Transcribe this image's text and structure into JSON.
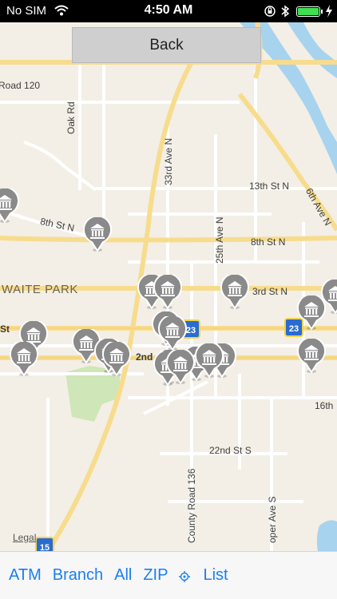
{
  "status": {
    "carrier": "No SIM",
    "time": "4:50 AM",
    "battery_level": 1.0,
    "icons": [
      "wifi-icon",
      "orientation-lock-icon",
      "bluetooth-icon",
      "battery-icon",
      "charging-bolt-icon"
    ]
  },
  "back_button": {
    "label": "Back"
  },
  "map": {
    "streets": {
      "road120": "Road 120",
      "oak_rd": "Oak Rd",
      "ave33": "33rd Ave N",
      "ave25": "25th Ave N",
      "st13": "13th St N",
      "ave6": "6th Ave N",
      "st8_west": "8th St N",
      "st8_east": "8th St N",
      "waite_park": "WAITE PARK",
      "st3": "3rd St N",
      "st_left": "St",
      "nd2": "2nd",
      "st16": "16th",
      "st22": "22nd St S",
      "county136": "County Road 136",
      "cooper": "oper Ave S"
    },
    "shields": [
      "23",
      "23",
      "15"
    ],
    "legal": "Legal",
    "pin_icon": "bank-icon",
    "pin_count": 21
  },
  "toolbar": {
    "atm": "ATM",
    "branch": "Branch",
    "all": "All",
    "zip": "ZIP",
    "list": "List",
    "accent": "#1a7ff2"
  },
  "colors": {
    "map_bg": "#f3efe6",
    "road_major": "#f7dc8e",
    "road_minor": "#ffffff",
    "water": "#a7d3ef",
    "park": "#cfe6b8",
    "pin": "#8a8a8a"
  }
}
